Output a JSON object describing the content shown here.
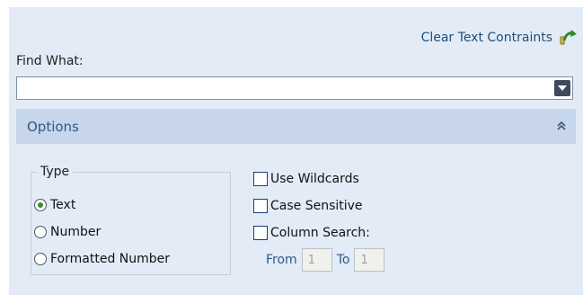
{
  "header": {
    "clear_label": "Clear Text Contraints"
  },
  "find": {
    "label": "Find What:",
    "value": "",
    "placeholder": ""
  },
  "options": {
    "title": "Options",
    "type_group": {
      "legend": "Type",
      "radios": [
        {
          "label": "Text",
          "checked": true
        },
        {
          "label": "Number",
          "checked": false
        },
        {
          "label": "Formatted Number",
          "checked": false
        }
      ]
    },
    "checkboxes": [
      {
        "label": "Use Wildcards",
        "checked": false
      },
      {
        "label": "Case Sensitive",
        "checked": false
      },
      {
        "label": "Column Search:",
        "checked": false
      }
    ],
    "column_search": {
      "from_label": "From",
      "from_value": "1",
      "to_label": "To",
      "to_value": "1"
    }
  },
  "colors": {
    "panel_bg": "#e3ebf7",
    "header_bg": "#c7d6ea",
    "title_blue": "#2d5a87",
    "radio_green": "#3c8a2a"
  },
  "icons": {
    "clear": "eraser-arrow-icon",
    "dropdown": "dropdown-arrow-icon",
    "collapse": "double-chevron-up-icon"
  }
}
